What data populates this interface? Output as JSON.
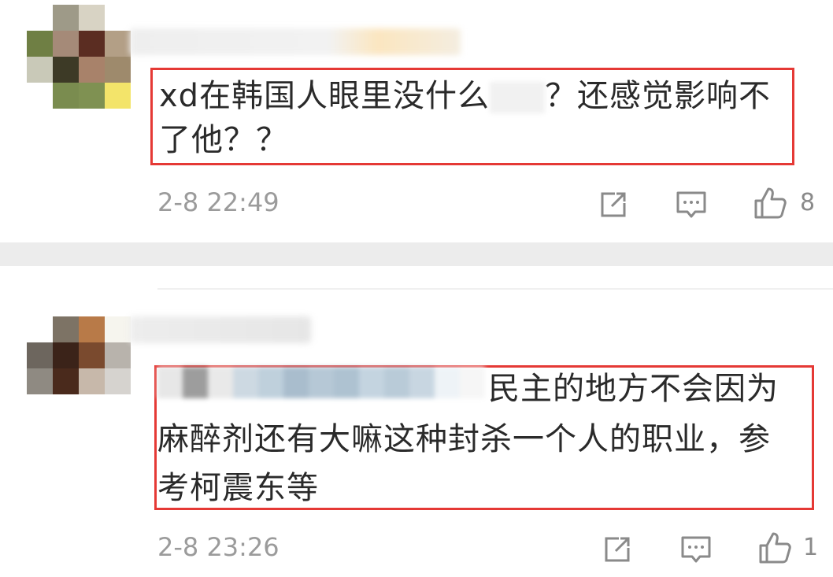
{
  "comments": [
    {
      "text_line1_a": "xd在韩国人眼里没什么",
      "text_line1_b": "？还感觉影响不",
      "text_line2": "了他？？",
      "timestamp": "2-8 22:49",
      "like_count": "8"
    },
    {
      "text_line1": "民主的地方不会因为",
      "text_line2": "麻醉剂还有大嘛这种封杀一个人的职业，参",
      "text_line3": "考柯震东等",
      "timestamp": "2-8 23:26",
      "like_count": "1"
    }
  ],
  "icons": {
    "share": "share-icon",
    "reply": "comment-icon",
    "like": "thumbs-up-icon"
  },
  "colors": {
    "highlight_box": "#e53935",
    "timestamp": "#9b9b9b",
    "text": "#2a2a2a"
  }
}
